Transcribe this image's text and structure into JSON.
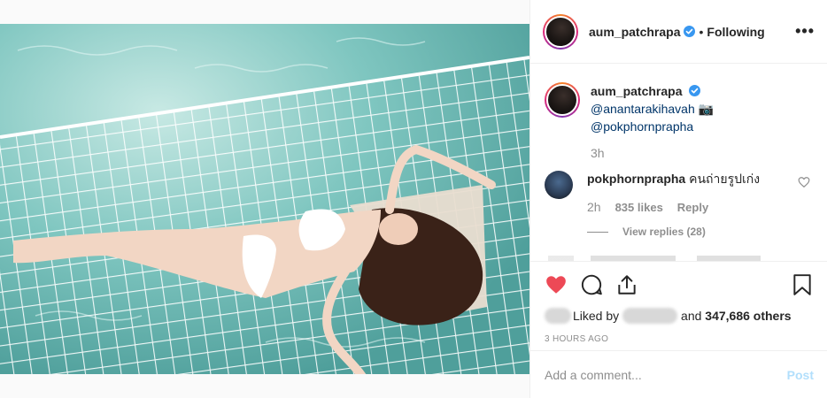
{
  "post": {
    "username": "aum_patchrapa",
    "follow_label": "Following",
    "separator": "•",
    "more_label": "•••"
  },
  "caption": {
    "username": "aum_patchrapa",
    "mention1": "@anantarakihavah",
    "camera": "📷",
    "mention2": "@pokphornprapha",
    "time": "3h"
  },
  "comment": {
    "username": "pokphornprapha",
    "text": "คนถ่ายรูปเก่ง",
    "time": "2h",
    "likes": "835 likes",
    "reply_label": "Reply",
    "view_replies": "View replies (28)"
  },
  "likes": {
    "liked_by": "Liked by",
    "and": "and",
    "others": "347,686 others"
  },
  "timestamp": "3 HOURS AGO",
  "add_comment": {
    "placeholder": "Add a comment...",
    "post_label": "Post"
  },
  "colors": {
    "heart": "#ed4956",
    "verified": "#3897f0",
    "link": "#003569",
    "post_disabled": "#b2dffc"
  }
}
